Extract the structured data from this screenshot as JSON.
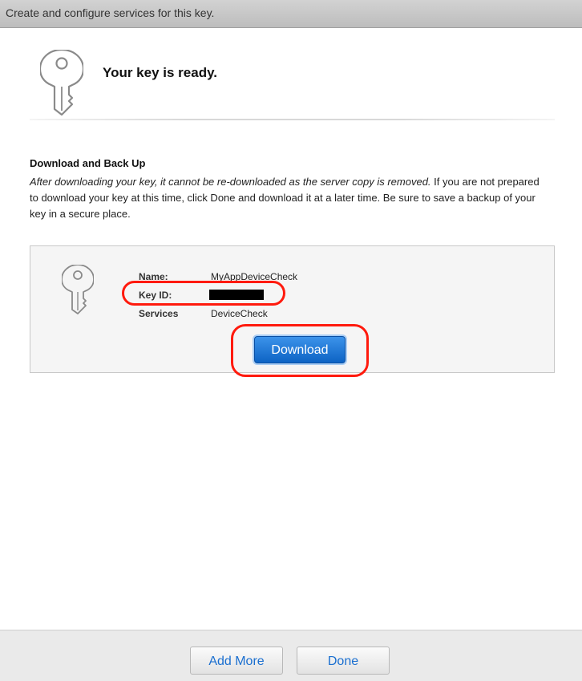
{
  "header": {
    "subtitle": "Create and configure services for this key."
  },
  "hero": {
    "title": "Your key is ready.",
    "icon": "key-icon"
  },
  "section": {
    "title": "Download and Back Up",
    "body_italic": "After downloading your key, it cannot be re-downloaded as the server copy is removed.",
    "body_rest": " If you are not prepared to download your key at this time, click Done and download it at a later time. Be sure to save a backup of your key in a secure place."
  },
  "key_card": {
    "icon": "key-icon",
    "fields": [
      {
        "label": "Name:",
        "value": "MyAppDeviceCheck"
      },
      {
        "label": "Key ID:",
        "value": ""
      },
      {
        "label": "Services",
        "value": "DeviceCheck"
      }
    ],
    "download_label": "Download"
  },
  "footer": {
    "add_more_label": "Add More",
    "done_label": "Done"
  },
  "colors": {
    "primary_button": "#1a73d6",
    "link_text": "#1a6fd0",
    "annotation_ring": "#ff1a0d"
  }
}
